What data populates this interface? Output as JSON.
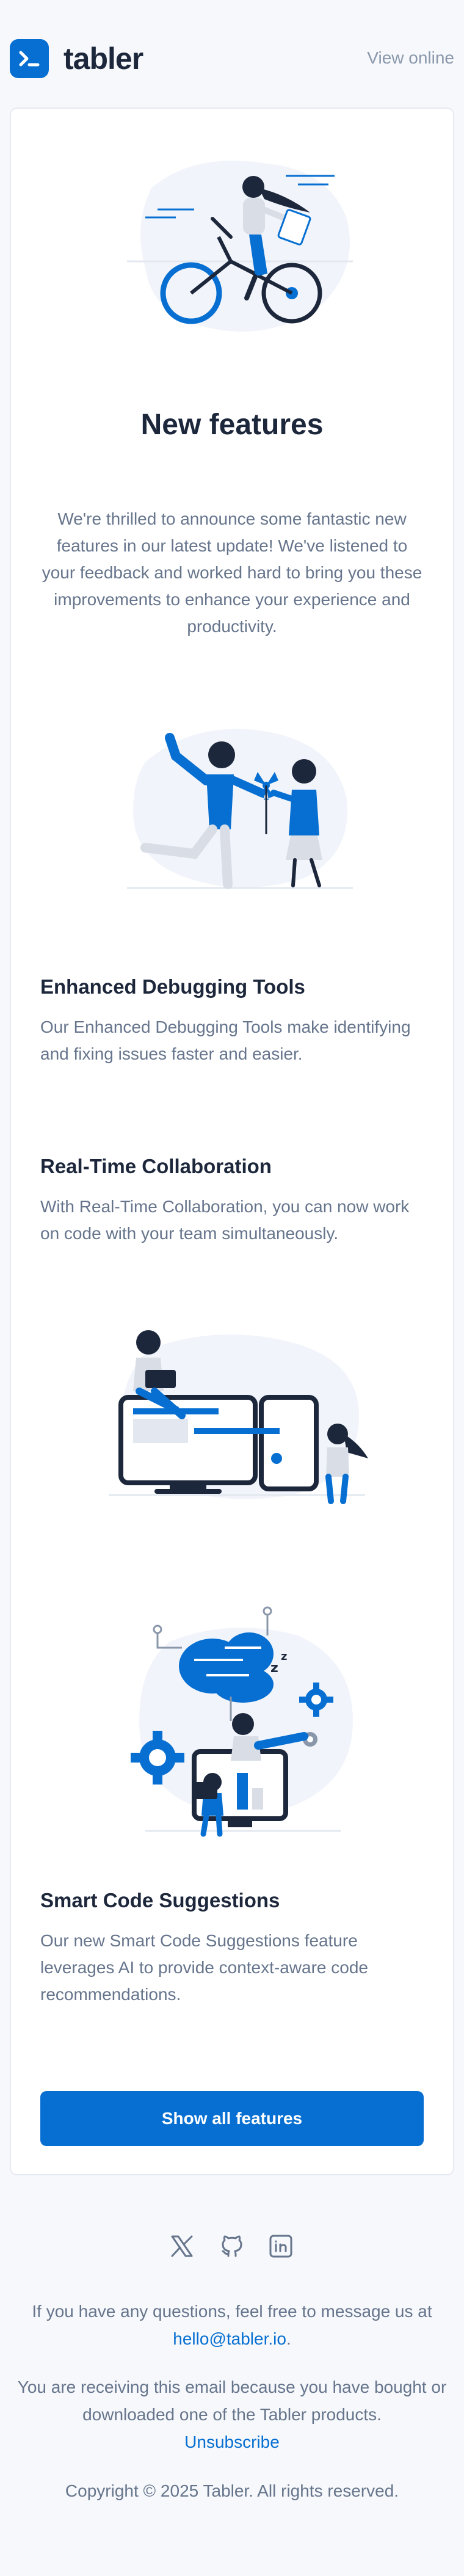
{
  "header": {
    "brand": "tabler",
    "view_online": "View online"
  },
  "hero": {
    "title": "New features",
    "intro": "We're thrilled to announce some fantastic new features in our latest update! We've listened to your feedback and worked hard to bring you these improvements to enhance your experience and productivity."
  },
  "features": [
    {
      "title": "Enhanced Debugging Tools",
      "description": "Our Enhanced Debugging Tools make identifying and fixing issues faster and easier."
    },
    {
      "title": "Real-Time Collaboration",
      "description": "With Real-Time Collaboration, you can now work on code with your team simultaneously."
    },
    {
      "title": "Smart Code Suggestions",
      "description": "Our new Smart Code Suggestions feature leverages AI to provide context-aware code recommendations."
    }
  ],
  "cta": {
    "label": "Show all features"
  },
  "social": [
    "x-icon",
    "github-icon",
    "linkedin-icon"
  ],
  "footer": {
    "questions": "If you have any questions, feel free to message us at",
    "email": "hello@tabler.io",
    "email_suffix": ".",
    "receiving": "You are receiving this email because you have bought or downloaded one of the Tabler products.",
    "unsubscribe": "Unsubscribe",
    "copyright": "Copyright © 2025 Tabler. All rights reserved."
  },
  "colors": {
    "primary": "#066fd1",
    "background": "#f6f8fb",
    "text": "#1d273b",
    "muted": "#66758c"
  }
}
